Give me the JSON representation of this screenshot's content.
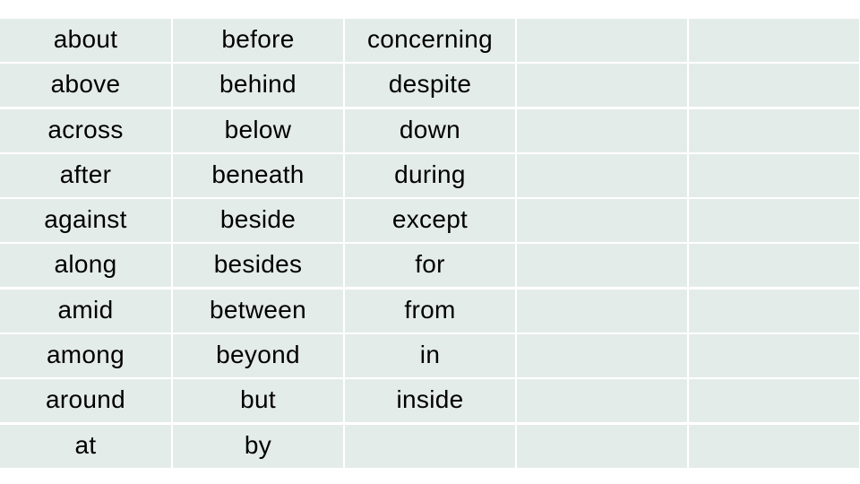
{
  "table": {
    "fill_color": "#e4ecea",
    "columns": [
      [
        "about",
        "above",
        "across",
        "after",
        "against",
        "along",
        "amid",
        "among",
        "around",
        "at"
      ],
      [
        "before",
        "behind",
        "below",
        "beneath",
        "beside",
        "besides",
        "between",
        "beyond",
        "but",
        "by"
      ],
      [
        "concerning",
        "despite",
        "down",
        "during",
        "except",
        "for",
        "from",
        "in",
        "inside",
        ""
      ],
      [
        "",
        "",
        "",
        "",
        "",
        "",
        "",
        "",
        "",
        ""
      ],
      [
        "",
        "",
        "",
        "",
        "",
        "",
        "",
        "",
        "",
        ""
      ]
    ]
  }
}
